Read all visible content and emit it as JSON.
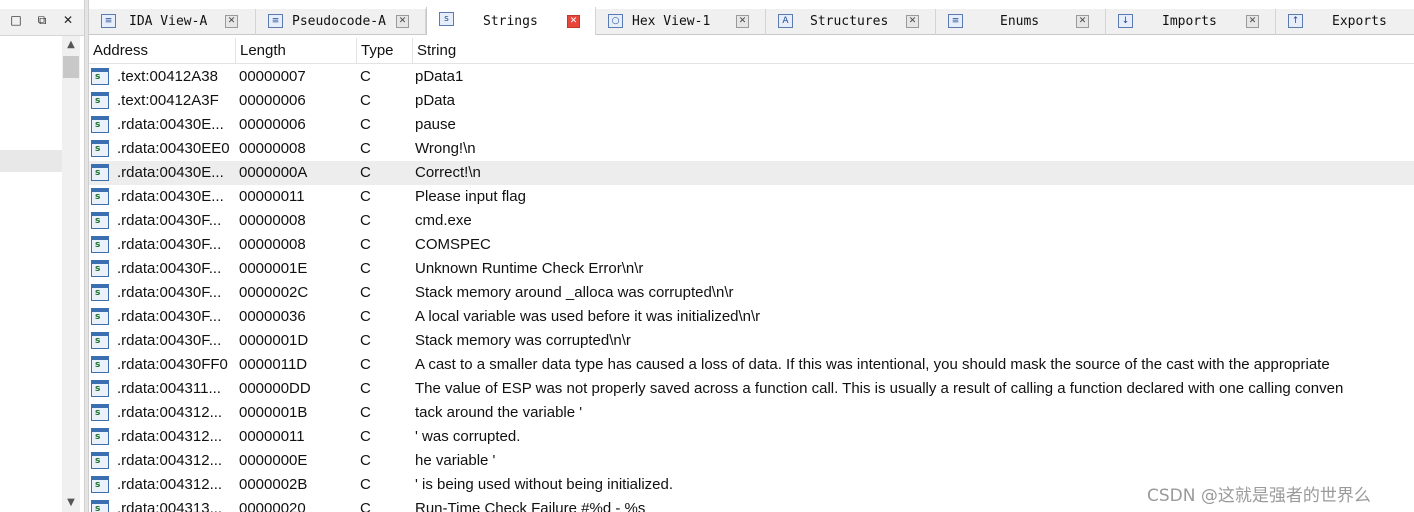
{
  "left_pane": {
    "buttons": [
      "□",
      "⧉",
      "✕"
    ]
  },
  "tabs": [
    {
      "label": "IDA View-A",
      "icon": "ida-view-icon",
      "glyph": "≡",
      "active": false
    },
    {
      "label": "Pseudocode-A",
      "icon": "pseudocode-icon",
      "glyph": "≡",
      "active": false
    },
    {
      "label": "Strings",
      "icon": "strings-icon",
      "glyph": "s",
      "active": true
    },
    {
      "label": "Hex View-1",
      "icon": "hex-view-icon",
      "glyph": "○",
      "active": false
    },
    {
      "label": "Structures",
      "icon": "structures-icon",
      "glyph": "A",
      "active": false
    },
    {
      "label": "Enums",
      "icon": "enums-icon",
      "glyph": "≡",
      "active": false
    },
    {
      "label": "Imports",
      "icon": "imports-icon",
      "glyph": "↓",
      "active": false
    },
    {
      "label": "Exports",
      "icon": "exports-icon",
      "glyph": "↑",
      "active": false
    }
  ],
  "table": {
    "columns": [
      "Address",
      "Length",
      "Type",
      "String"
    ],
    "rows": [
      {
        "address": ".text:00412A38",
        "length": "00000007",
        "type": "C",
        "string": "pData1"
      },
      {
        "address": ".text:00412A3F",
        "length": "00000006",
        "type": "C",
        "string": "pData"
      },
      {
        "address": ".rdata:00430E...",
        "length": "00000006",
        "type": "C",
        "string": "pause"
      },
      {
        "address": ".rdata:00430EE0",
        "length": "00000008",
        "type": "C",
        "string": "Wrong!\\n"
      },
      {
        "address": ".rdata:00430E...",
        "length": "0000000A",
        "type": "C",
        "string": "Correct!\\n",
        "selected": true
      },
      {
        "address": ".rdata:00430E...",
        "length": "00000011",
        "type": "C",
        "string": "Please input flag"
      },
      {
        "address": ".rdata:00430F...",
        "length": "00000008",
        "type": "C",
        "string": "cmd.exe"
      },
      {
        "address": ".rdata:00430F...",
        "length": "00000008",
        "type": "C",
        "string": "COMSPEC"
      },
      {
        "address": ".rdata:00430F...",
        "length": "0000001E",
        "type": "C",
        "string": "Unknown Runtime Check Error\\n\\r"
      },
      {
        "address": ".rdata:00430F...",
        "length": "0000002C",
        "type": "C",
        "string": "Stack memory around _alloca was corrupted\\n\\r"
      },
      {
        "address": ".rdata:00430F...",
        "length": "00000036",
        "type": "C",
        "string": "A local variable was used before it was initialized\\n\\r"
      },
      {
        "address": ".rdata:00430F...",
        "length": "0000001D",
        "type": "C",
        "string": "Stack memory was corrupted\\n\\r"
      },
      {
        "address": ".rdata:00430FF0",
        "length": "0000011D",
        "type": "C",
        "string": "A cast to a smaller data type has caused a loss of data.  If this was intentional, you should mask the source of the cast with the appropriate"
      },
      {
        "address": ".rdata:004311...",
        "length": "000000DD",
        "type": "C",
        "string": "The value of ESP was not properly saved across a function call.  This is usually a result of calling a function declared with one calling conven"
      },
      {
        "address": ".rdata:004312...",
        "length": "0000001B",
        "type": "C",
        "string": "tack around the variable '"
      },
      {
        "address": ".rdata:004312...",
        "length": "00000011",
        "type": "C",
        "string": "' was corrupted."
      },
      {
        "address": ".rdata:004312...",
        "length": "0000000E",
        "type": "C",
        "string": "he variable '"
      },
      {
        "address": ".rdata:004312...",
        "length": "0000002B",
        "type": "C",
        "string": "' is being used without being initialized."
      },
      {
        "address": ".rdata:004313...",
        "length": "00000020",
        "type": "C",
        "string": "Run-Time Check Failure #%d - %s"
      }
    ]
  },
  "watermark": "CSDN @这就是强者的世界么"
}
